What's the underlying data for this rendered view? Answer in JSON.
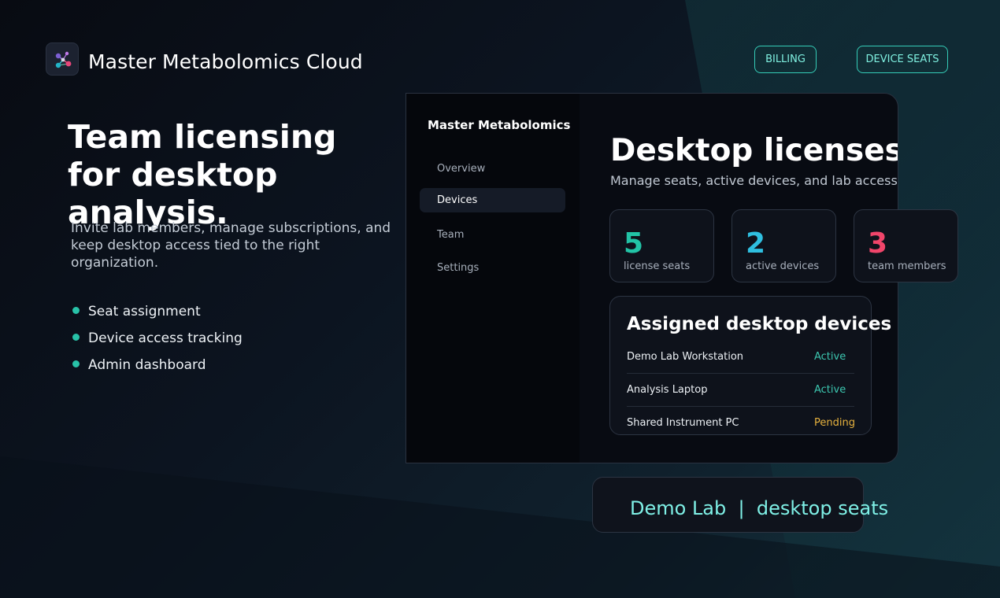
{
  "app": {
    "logo_icon": "molecule-network-icon",
    "title": "Master Metabolomics Cloud"
  },
  "header": {
    "billing_label": "BILLING",
    "device_seats_label": "DEVICE SEATS"
  },
  "hero": {
    "title": "Team licensing for desktop analysis.",
    "subtitle": "Invite lab members, manage subscriptions, and keep desktop access tied to the right organization.",
    "features": [
      "Seat assignment",
      "Device access tracking",
      "Admin dashboard"
    ]
  },
  "sidebar": {
    "brand": "Master Metabolomics",
    "items": [
      {
        "label": "Overview",
        "active": false
      },
      {
        "label": "Devices",
        "active": true
      },
      {
        "label": "Team",
        "active": false
      },
      {
        "label": "Settings",
        "active": false
      }
    ]
  },
  "main": {
    "title": "Desktop licenses",
    "subtitle": "Manage seats, active devices, and lab access."
  },
  "stats": [
    {
      "value": "5",
      "label": "license seats",
      "color": "#22c3a6"
    },
    {
      "value": "2",
      "label": "active devices",
      "color": "#2fbfe0"
    },
    {
      "value": "3",
      "label": "team members",
      "color": "#f0456a"
    }
  ],
  "devices": {
    "title": "Assigned desktop devices",
    "rows": [
      {
        "name": "Demo Lab Workstation",
        "status": "Active",
        "status_color": "#3cc7b0"
      },
      {
        "name": "Analysis Laptop",
        "status": "Active",
        "status_color": "#3cc7b0"
      },
      {
        "name": "Shared Instrument PC",
        "status": "Pending",
        "status_color": "#e7b23e"
      }
    ]
  },
  "footer": {
    "text": "Demo Lab  |  desktop seats"
  },
  "colors": {
    "accent": "#35cdb8",
    "feature_dot": "#28c2a8"
  }
}
